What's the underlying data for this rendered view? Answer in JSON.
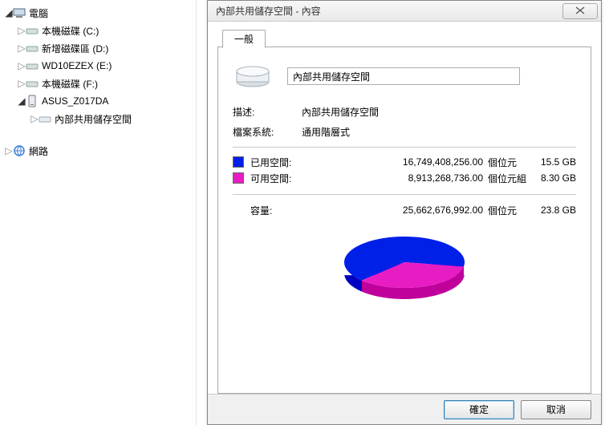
{
  "tree": {
    "root": "電腦",
    "drives": [
      "本機磁碟 (C:)",
      "新增磁碟區 (D:)",
      "WD10EZEX (E:)",
      "本機磁碟 (F:)"
    ],
    "device": "ASUS_Z017DA",
    "device_child": "內部共用儲存空間",
    "network": "網路"
  },
  "dialog": {
    "title": "內部共用儲存空間 - 內容",
    "tab": "一般",
    "name_value": "內部共用儲存空間",
    "desc_label": "描述:",
    "desc_value": "內部共用儲存空間",
    "fs_label": "檔案系統:",
    "fs_value": "通用階層式",
    "used_label": "已用空間:",
    "used_bytes": "16,749,408,256.00",
    "used_unit": "個位元",
    "used_hr": "15.5 GB",
    "free_label": "可用空間:",
    "free_bytes": "8,913,268,736.00",
    "free_unit": "個位元組",
    "free_hr": "8.30 GB",
    "cap_label": "容量:",
    "cap_bytes": "25,662,676,992.00",
    "cap_unit": "個位元",
    "cap_hr": "23.8 GB",
    "ok": "確定",
    "cancel": "取消"
  },
  "chart_data": {
    "type": "pie",
    "title": "",
    "series": [
      {
        "name": "已用空間",
        "value": 16749408256,
        "color": "#0020e8"
      },
      {
        "name": "可用空間",
        "value": 8913268736,
        "color": "#e81cc3"
      }
    ]
  }
}
